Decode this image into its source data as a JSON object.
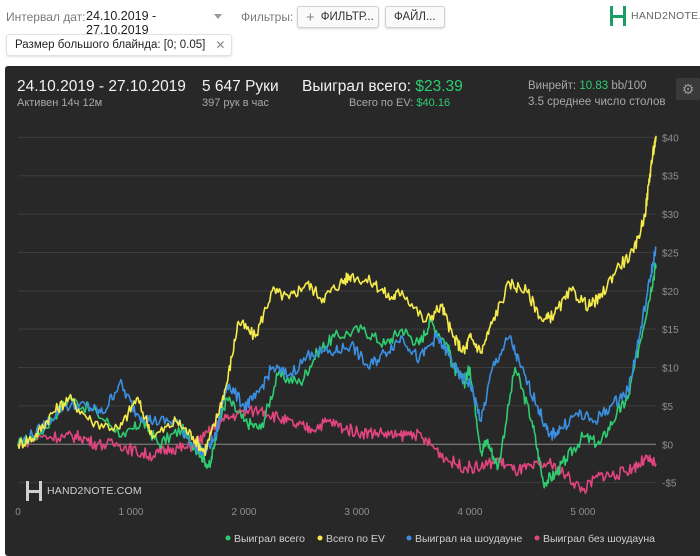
{
  "toolbar": {
    "date_label": "Интервал дат:",
    "date_value": "24.10.2019 - 27.10.2019",
    "filters_label": "Фильтры:",
    "filter_button": "ФИЛЬТР...",
    "file_button": "ФАЙЛ...",
    "logo_text": "HAND2NOTE.COM"
  },
  "active_filter": {
    "label": "Размер большого блайнда: [0; 0.05]",
    "remove_glyph": "✕"
  },
  "summary": {
    "period": "24.10.2019 - 27.10.2019",
    "active": "Активен 14ч 12м",
    "hands": "5 647 Руки",
    "hands_per_hour": "397 рук в час",
    "won_total_label": "Выиграл всего:",
    "won_total_value": "$23.39",
    "ev_total_label": "Всего по EV:",
    "ev_total_value": "$40.16",
    "winrate_label": "Винрейт:",
    "winrate_value": "10.83",
    "winrate_suffix": "bb/100",
    "avg_tables": "3.5 среднее число столов"
  },
  "chart_data": {
    "type": "line",
    "xlabel": "",
    "ylabel": "",
    "x_ticks": [
      "0",
      "1 000",
      "2 000",
      "3 000",
      "4 000",
      "5 000"
    ],
    "y_ticks": [
      "$40",
      "$35",
      "$30",
      "$25",
      "$20",
      "$15",
      "$10",
      "$5",
      "$0",
      "-$5"
    ],
    "xlim": [
      0,
      5647
    ],
    "ylim": [
      -7,
      42
    ],
    "legend_position": "bottom",
    "watermark": "HAND2NOTE.COM",
    "series": [
      {
        "name": "Выиграл всего",
        "color": "#2ecc71",
        "points": [
          [
            0,
            0
          ],
          [
            200,
            1.5
          ],
          [
            450,
            6
          ],
          [
            700,
            4
          ],
          [
            950,
            1
          ],
          [
            1100,
            3
          ],
          [
            1250,
            0
          ],
          [
            1450,
            2
          ],
          [
            1600,
            -1
          ],
          [
            1700,
            -3
          ],
          [
            1760,
            2
          ],
          [
            1850,
            6
          ],
          [
            2000,
            3
          ],
          [
            2150,
            2
          ],
          [
            2300,
            9
          ],
          [
            2500,
            8
          ],
          [
            2650,
            12
          ],
          [
            2800,
            14
          ],
          [
            3050,
            15
          ],
          [
            3250,
            13
          ],
          [
            3400,
            15
          ],
          [
            3550,
            13
          ],
          [
            3650,
            16
          ],
          [
            3800,
            13
          ],
          [
            3850,
            10
          ],
          [
            3950,
            8
          ],
          [
            4000,
            10
          ],
          [
            4100,
            -1
          ],
          [
            4150,
            0.5
          ],
          [
            4250,
            -3
          ],
          [
            4400,
            10
          ],
          [
            4550,
            3
          ],
          [
            4650,
            -5
          ],
          [
            4750,
            -4
          ],
          [
            4850,
            -2
          ],
          [
            5000,
            1
          ],
          [
            5150,
            0
          ],
          [
            5300,
            4
          ],
          [
            5400,
            6
          ],
          [
            5500,
            13
          ],
          [
            5600,
            20
          ],
          [
            5647,
            23.4
          ]
        ]
      },
      {
        "name": "Всего по EV",
        "color": "#f4ea4a",
        "points": [
          [
            0,
            0
          ],
          [
            150,
            1
          ],
          [
            300,
            4
          ],
          [
            450,
            6
          ],
          [
            650,
            3
          ],
          [
            900,
            2
          ],
          [
            1050,
            6
          ],
          [
            1200,
            1
          ],
          [
            1400,
            3
          ],
          [
            1550,
            1
          ],
          [
            1650,
            -1
          ],
          [
            1750,
            3
          ],
          [
            1850,
            8
          ],
          [
            1950,
            16
          ],
          [
            2100,
            14
          ],
          [
            2250,
            20
          ],
          [
            2400,
            19
          ],
          [
            2550,
            21
          ],
          [
            2700,
            19
          ],
          [
            2850,
            21
          ],
          [
            2950,
            22
          ],
          [
            3150,
            21
          ],
          [
            3300,
            19
          ],
          [
            3400,
            20
          ],
          [
            3600,
            16
          ],
          [
            3750,
            18
          ],
          [
            3850,
            14
          ],
          [
            3950,
            12
          ],
          [
            4000,
            14
          ],
          [
            4100,
            12
          ],
          [
            4200,
            16
          ],
          [
            4350,
            21
          ],
          [
            4500,
            20
          ],
          [
            4650,
            16
          ],
          [
            4750,
            17
          ],
          [
            4900,
            20
          ],
          [
            5050,
            18
          ],
          [
            5150,
            19
          ],
          [
            5300,
            23
          ],
          [
            5450,
            25
          ],
          [
            5550,
            30
          ],
          [
            5600,
            36
          ],
          [
            5647,
            40.2
          ]
        ]
      },
      {
        "name": "Выиграл на шоудауне",
        "color": "#3a8fe0",
        "points": [
          [
            0,
            0
          ],
          [
            200,
            2
          ],
          [
            400,
            5
          ],
          [
            600,
            5
          ],
          [
            750,
            4
          ],
          [
            900,
            8
          ],
          [
            1050,
            4
          ],
          [
            1200,
            3
          ],
          [
            1400,
            3
          ],
          [
            1550,
            0
          ],
          [
            1650,
            -1
          ],
          [
            1750,
            1
          ],
          [
            1850,
            8
          ],
          [
            2000,
            5
          ],
          [
            2100,
            6
          ],
          [
            2250,
            10
          ],
          [
            2400,
            9
          ],
          [
            2600,
            12
          ],
          [
            2800,
            12
          ],
          [
            2950,
            13
          ],
          [
            3100,
            10
          ],
          [
            3250,
            12
          ],
          [
            3400,
            14
          ],
          [
            3550,
            11
          ],
          [
            3700,
            14
          ],
          [
            3800,
            12
          ],
          [
            3900,
            9
          ],
          [
            4000,
            8
          ],
          [
            4100,
            3
          ],
          [
            4200,
            10
          ],
          [
            4350,
            14
          ],
          [
            4450,
            10
          ],
          [
            4600,
            5
          ],
          [
            4700,
            1
          ],
          [
            4800,
            2
          ],
          [
            4950,
            4
          ],
          [
            5100,
            3
          ],
          [
            5250,
            5
          ],
          [
            5400,
            7
          ],
          [
            5500,
            14
          ],
          [
            5600,
            22
          ],
          [
            5647,
            25.6
          ]
        ]
      },
      {
        "name": "Выиграл без шоудауна",
        "color": "#e0457e",
        "points": [
          [
            0,
            0
          ],
          [
            200,
            1
          ],
          [
            400,
            1
          ],
          [
            550,
            1
          ],
          [
            700,
            0
          ],
          [
            900,
            0
          ],
          [
            1050,
            -1
          ],
          [
            1200,
            -1.5
          ],
          [
            1350,
            -0.5
          ],
          [
            1500,
            -0.5
          ],
          [
            1650,
            1
          ],
          [
            1800,
            3
          ],
          [
            1950,
            4
          ],
          [
            2150,
            4.5
          ],
          [
            2300,
            3.5
          ],
          [
            2450,
            2.5
          ],
          [
            2600,
            2
          ],
          [
            2750,
            3
          ],
          [
            2900,
            2
          ],
          [
            3050,
            1.5
          ],
          [
            3200,
            1.5
          ],
          [
            3350,
            1
          ],
          [
            3500,
            1.5
          ],
          [
            3650,
            0
          ],
          [
            3800,
            -2
          ],
          [
            3950,
            -3
          ],
          [
            4100,
            -3
          ],
          [
            4250,
            -2
          ],
          [
            4400,
            -3.5
          ],
          [
            4550,
            -3
          ],
          [
            4700,
            -2.5
          ],
          [
            4850,
            -4
          ],
          [
            5000,
            -6
          ],
          [
            5150,
            -4
          ],
          [
            5300,
            -4
          ],
          [
            5450,
            -3
          ],
          [
            5550,
            -2
          ],
          [
            5647,
            -2.5
          ]
        ]
      }
    ]
  }
}
